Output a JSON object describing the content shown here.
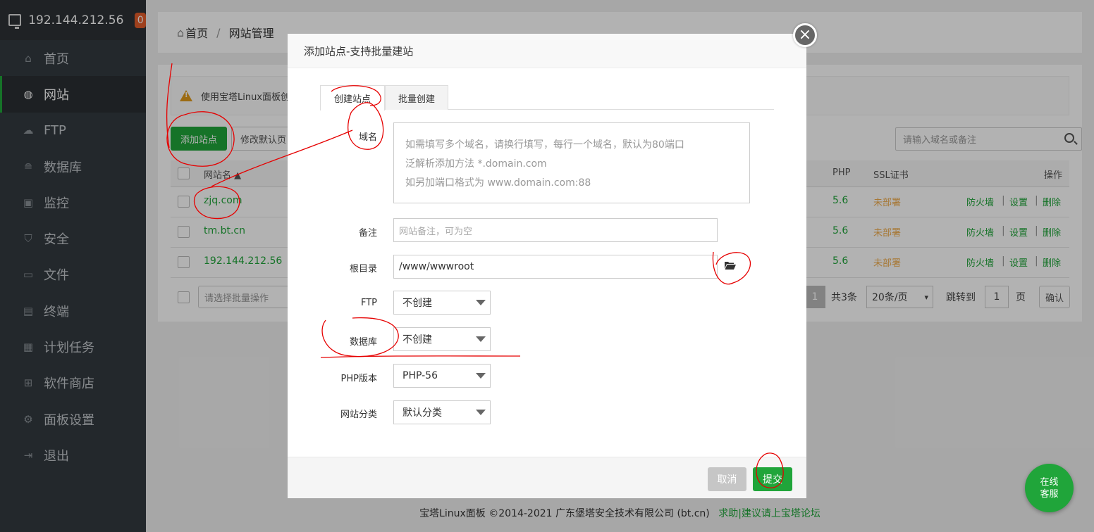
{
  "sidebar": {
    "server_ip": "192.144.212.56",
    "badge_count": "0",
    "items": [
      {
        "label": "首页",
        "icon": "home-icon"
      },
      {
        "label": "网站",
        "icon": "globe-icon"
      },
      {
        "label": "FTP",
        "icon": "ftp-icon"
      },
      {
        "label": "数据库",
        "icon": "database-icon"
      },
      {
        "label": "监控",
        "icon": "monitor-icon"
      },
      {
        "label": "安全",
        "icon": "shield-icon"
      },
      {
        "label": "文件",
        "icon": "folder-icon"
      },
      {
        "label": "终端",
        "icon": "terminal-icon"
      },
      {
        "label": "计划任务",
        "icon": "calendar-icon"
      },
      {
        "label": "软件商店",
        "icon": "apps-icon"
      },
      {
        "label": "面板设置",
        "icon": "gear-icon"
      },
      {
        "label": "退出",
        "icon": "logout-icon"
      }
    ]
  },
  "breadcrumb": {
    "home": "首页",
    "sep": "/",
    "current": "网站管理"
  },
  "notice": "使用宝塔Linux面板创",
  "toolbar": {
    "add_site": "添加站点",
    "modify_default": "修改默认页",
    "search_placeholder": "请输入域名或备注"
  },
  "table": {
    "headers": {
      "name": "网站名 ▲",
      "php": "PHP",
      "ssl": "SSL证书",
      "ops": "操作"
    },
    "rows": [
      {
        "name": "zjq.com",
        "php": "5.6",
        "ssl": "未部署",
        "firewall": "防火墙",
        "settings": "设置",
        "delete": "删除"
      },
      {
        "name": "tm.bt.cn",
        "php": "5.6",
        "ssl": "未部署",
        "firewall": "防火墙",
        "settings": "设置",
        "delete": "删除"
      },
      {
        "name": "192.144.212.56",
        "php": "5.6",
        "ssl": "未部署",
        "firewall": "防火墙",
        "settings": "设置",
        "delete": "删除"
      }
    ],
    "op_sep": "|"
  },
  "pager": {
    "batch_placeholder": "请选择批量操作",
    "current_page": "1",
    "total": "共3条",
    "per_page": "20条/页",
    "jump_label": "跳转到",
    "jump_value": "1",
    "page_unit": "页",
    "confirm": "确认"
  },
  "footer": {
    "copyright": "宝塔Linux面板 ©2014-2021 广东堡塔安全技术有限公司 (bt.cn)",
    "link": "求助|建议请上宝塔论坛"
  },
  "modal": {
    "title": "添加站点-支持批量建站",
    "close_symbol": "×",
    "tabs": [
      "创建站点",
      "批量创建"
    ],
    "domain_label": "域名",
    "domain_hints": [
      "如需填写多个域名，请换行填写，每行一个域名，默认为80端口",
      "泛解析添加方法 *.domain.com",
      "如另加端口格式为 www.domain.com:88"
    ],
    "remark_label": "备注",
    "remark_placeholder": "网站备注，可为空",
    "root_label": "根目录",
    "root_value": "/www/wwwroot",
    "ftp_label": "FTP",
    "ftp_value": "不创建",
    "db_label": "数据库",
    "db_value": "不创建",
    "php_label": "PHP版本",
    "php_value": "PHP-56",
    "category_label": "网站分类",
    "category_value": "默认分类",
    "cancel": "取消",
    "submit": "提交"
  },
  "chat": {
    "line1": "在线",
    "line2": "客服"
  },
  "colors": {
    "accent": "#20a53a",
    "sidebar": "#333a40",
    "warning": "#f0ad4e",
    "annotation": "#e60000"
  }
}
